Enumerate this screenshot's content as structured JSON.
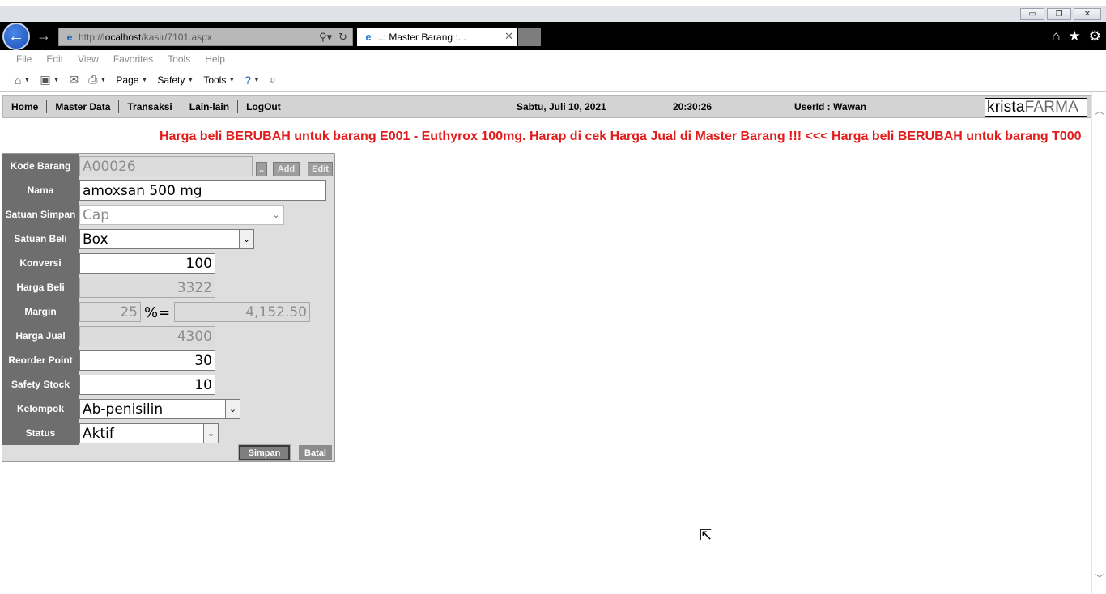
{
  "window": {
    "minimize_glyph": "▭",
    "restore_glyph": "❐",
    "close_glyph": "✕"
  },
  "browser": {
    "back_glyph": "←",
    "forward_glyph": "→",
    "url_prefix": "http://",
    "url_host": "localhost",
    "url_path": "/kasir/7101.aspx",
    "tab_title": "..: Master Barang :...",
    "menu": [
      "File",
      "Edit",
      "View",
      "Favorites",
      "Tools",
      "Help"
    ],
    "commands": {
      "page": "Page",
      "safety": "Safety",
      "tools": "Tools"
    }
  },
  "nav": {
    "items": [
      "Home",
      "Master Data",
      "Transaksi",
      "Lain-lain",
      "LogOut"
    ],
    "date": "Sabtu, Juli 10, 2021",
    "time": "20:30:26",
    "user": "UserId : Wawan",
    "logo_part1": "krista",
    "logo_part2": "FARMA"
  },
  "marquee": {
    "text": "Harga beli BERUBAH untuk barang E001 - Euthyrox 100mg. Harap di cek Harga Jual di Master Barang !!!   <<<   Harga beli BERUBAH untuk barang T000"
  },
  "form": {
    "kode_barang": {
      "label": "Kode Barang",
      "value": "A00026",
      "search_btn": "..",
      "add_btn": "Add",
      "edit_btn": "Edit"
    },
    "nama": {
      "label": "Nama",
      "value": "amoxsan 500 mg"
    },
    "satuan_simpan": {
      "label": "Satuan Simpan",
      "value": "Cap"
    },
    "satuan_beli": {
      "label": "Satuan Beli",
      "value": "Box"
    },
    "konversi": {
      "label": "Konversi",
      "value": "100"
    },
    "harga_beli": {
      "label": "Harga Beli",
      "value": "3322"
    },
    "margin": {
      "label": "Margin",
      "value": "25",
      "pct_label": "%=",
      "amount": "4,152.50"
    },
    "harga_jual": {
      "label": "Harga Jual",
      "value": "4300"
    },
    "reorder_point": {
      "label": "Reorder Point",
      "value": "30"
    },
    "safety_stock": {
      "label": "Safety Stock",
      "value": "10"
    },
    "kelompok": {
      "label": "Kelompok",
      "value": "Ab-penisilin"
    },
    "status": {
      "label": "Status",
      "value": "Aktif"
    },
    "simpan_btn": "Simpan",
    "batal_btn": "Batal"
  }
}
